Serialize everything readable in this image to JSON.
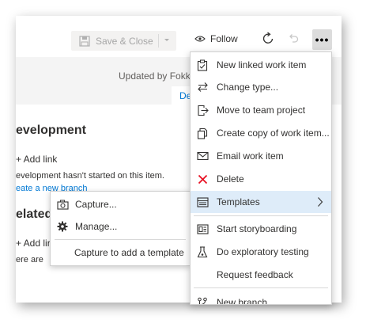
{
  "toolbar": {
    "save_label": "Save & Close",
    "follow_label": "Follow",
    "more_label": "•••"
  },
  "header": {
    "updated_text": "Updated by Fokk",
    "detail_tab": "De"
  },
  "development": {
    "heading": "evelopment",
    "add_link": "+ Add link",
    "status_text": "evelopment hasn't started on this item.",
    "branch_link": "eate a new branch"
  },
  "related": {
    "heading": "elated",
    "add_link": "+ Add lir",
    "text": "ere are"
  },
  "templates_submenu": {
    "items": [
      {
        "label": "Capture...",
        "icon": "camera-icon"
      },
      {
        "label": "Manage...",
        "icon": "gear-icon"
      }
    ],
    "hint": "Capture to add a template"
  },
  "more_menu": {
    "items": [
      {
        "label": "New linked work item",
        "icon": "clipboard-check-icon"
      },
      {
        "label": "Change type...",
        "icon": "swap-arrows-icon"
      },
      {
        "label": "Move to team project",
        "icon": "move-out-icon"
      },
      {
        "label": "Create copy of work item...",
        "icon": "copy-icon"
      },
      {
        "label": "Email work item",
        "icon": "envelope-icon"
      },
      {
        "label": "Delete",
        "icon": "red-x-icon"
      },
      {
        "label": "Templates",
        "icon": "template-icon"
      },
      {
        "label": "Start storyboarding",
        "icon": "storyboard-icon"
      },
      {
        "label": "Do exploratory testing",
        "icon": "flask-icon"
      },
      {
        "label": "Request feedback",
        "icon": ""
      },
      {
        "label": "New branch...",
        "icon": "branch-icon"
      }
    ]
  },
  "colors": {
    "accent": "#0078d4",
    "delete_red": "#e81123",
    "highlight": "#deecf9"
  }
}
